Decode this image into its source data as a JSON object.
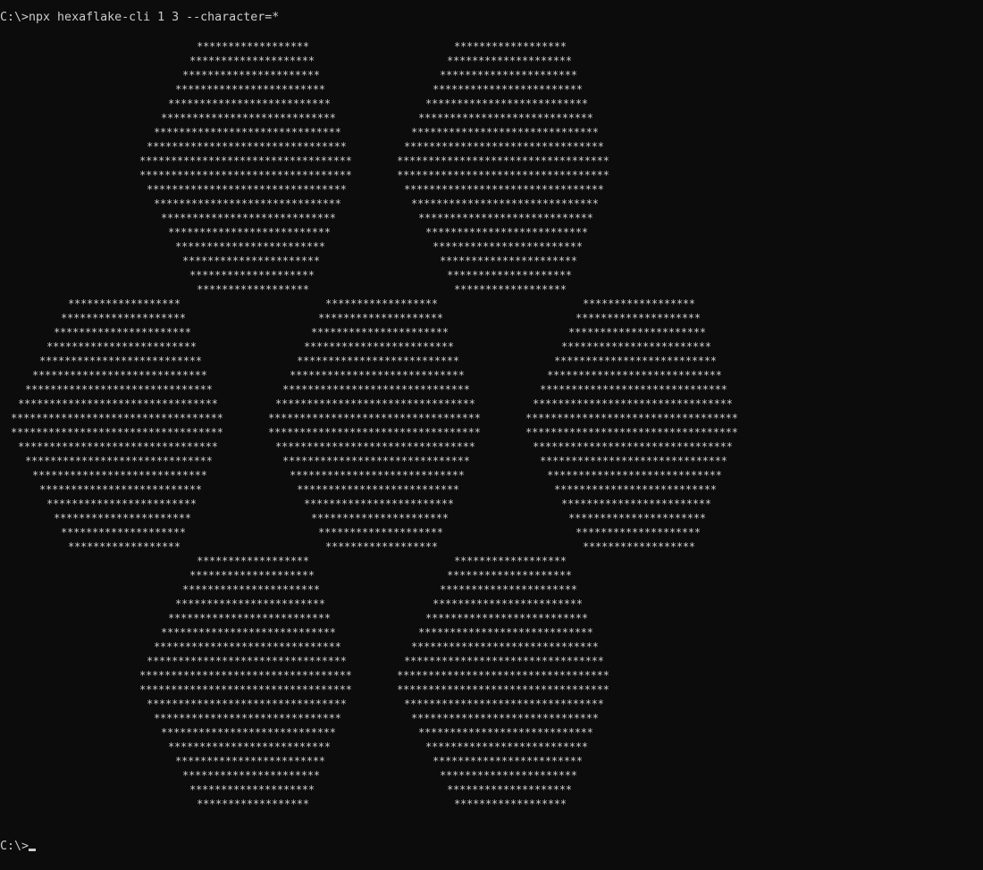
{
  "terminal": {
    "command_prompt": "C:\\>",
    "command": "npx hexaflake-cli 1 3 --character=*",
    "final_prompt": "C:\\>"
  },
  "hexaflake": {
    "character": "*",
    "hexagon_row_widths": [
      18,
      20,
      22,
      24,
      26,
      28,
      30,
      32,
      34,
      34,
      32,
      30,
      28,
      26,
      24,
      22,
      20,
      18
    ],
    "hexagon_count": 7
  }
}
